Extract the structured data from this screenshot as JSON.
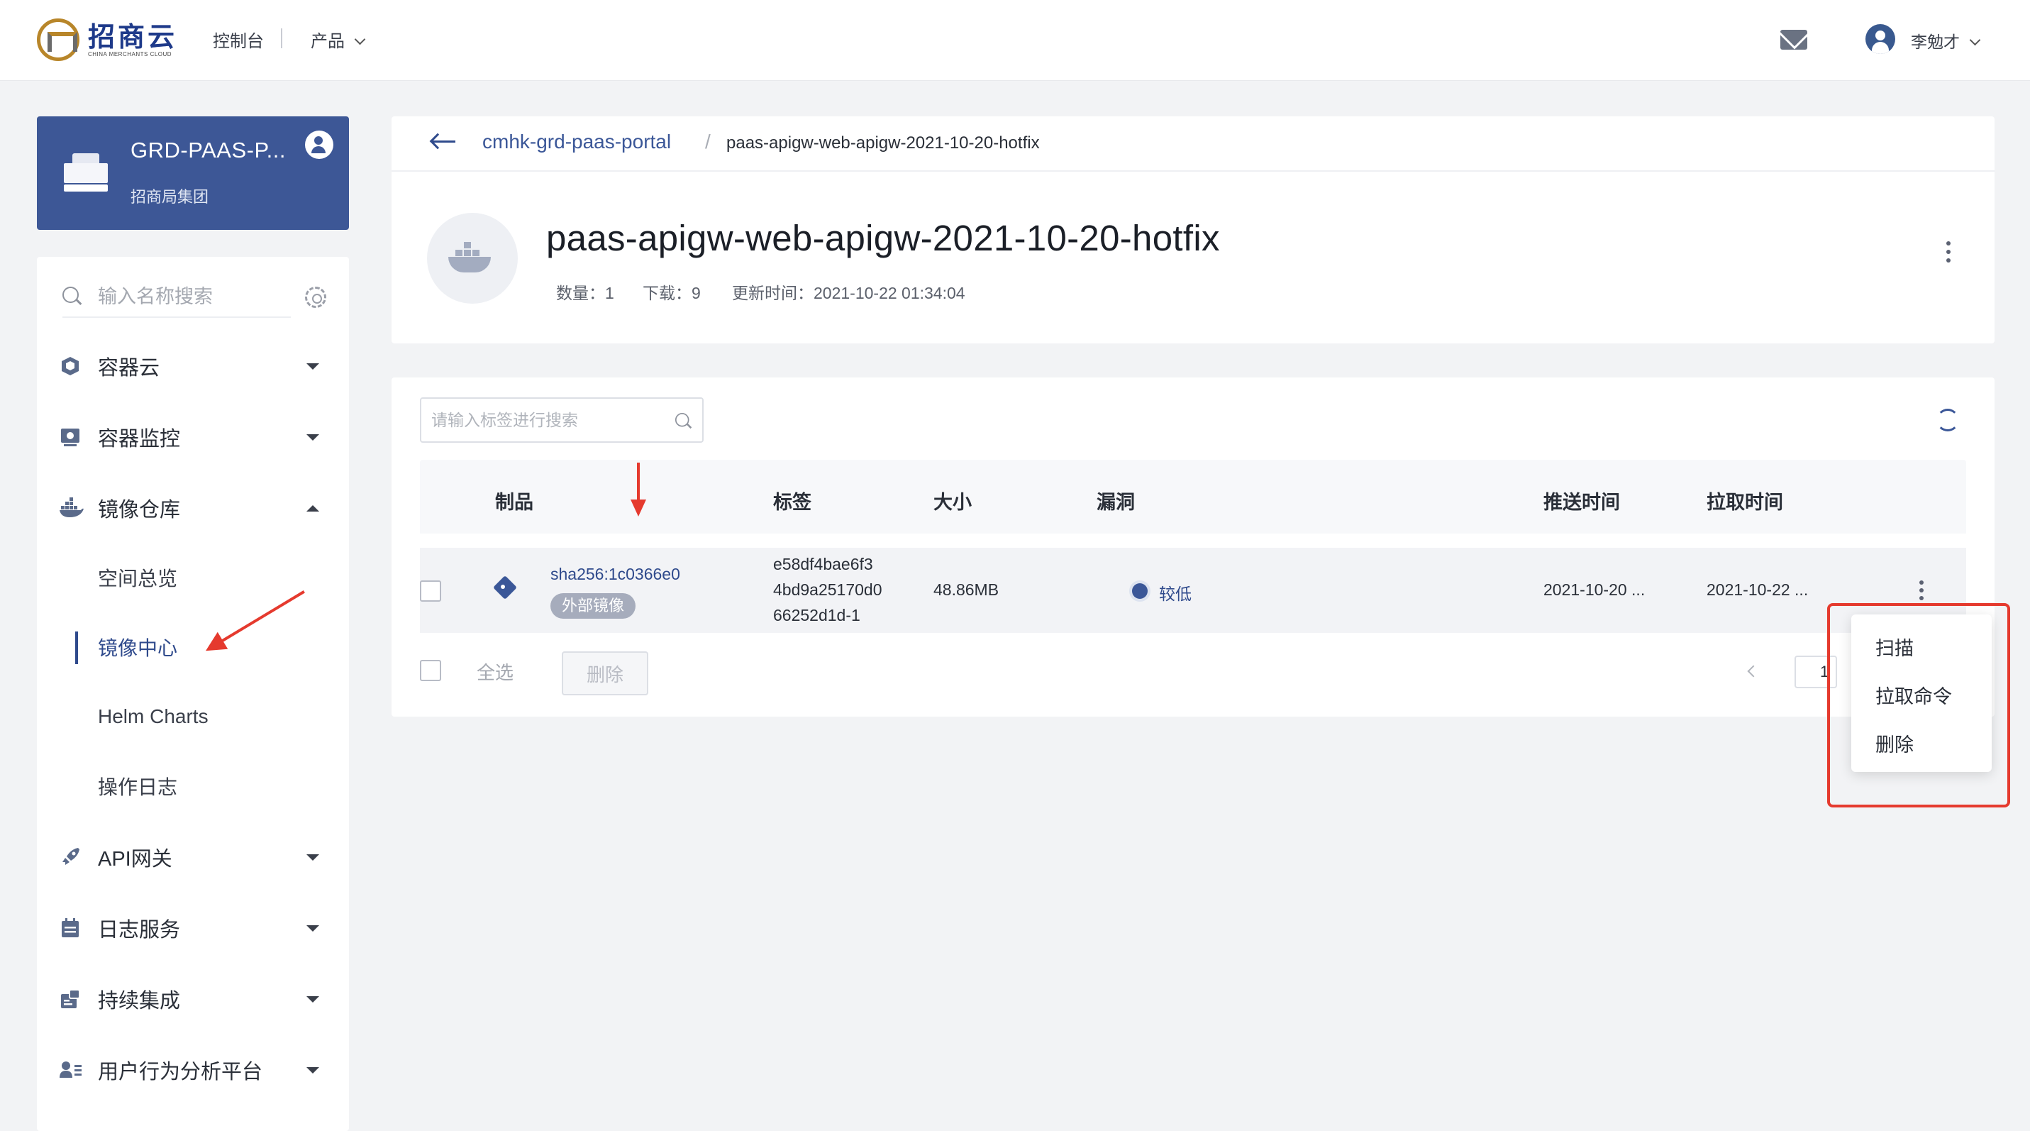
{
  "topnav": {
    "logo_cn": "招商云",
    "logo_en": "CHINA MERCHANTS CLOUD",
    "console": "控制台",
    "products": "产品",
    "username": "李勉才"
  },
  "project": {
    "name": "GRD-PAAS-P...",
    "org": "招商局集团"
  },
  "sidebar": {
    "search_placeholder": "输入名称搜索",
    "items": [
      {
        "label": "容器云",
        "icon": "cube-icon"
      },
      {
        "label": "容器监控",
        "icon": "monitor-icon"
      },
      {
        "label": "镜像仓库",
        "icon": "docker-whale-icon"
      },
      {
        "label": "API网关",
        "icon": "rocket-icon"
      },
      {
        "label": "日志服务",
        "icon": "calendar-log-icon"
      },
      {
        "label": "持续集成",
        "icon": "pipeline-icon"
      },
      {
        "label": "用户行为分析平台",
        "icon": "user-list-icon"
      }
    ],
    "sub_items": [
      "空间总览",
      "镜像中心",
      "Helm Charts",
      "操作日志"
    ],
    "active_sub": "镜像中心"
  },
  "breadcrumb": {
    "parent": "cmhk-grd-paas-portal",
    "separator": "/",
    "current": "paas-apigw-web-apigw-2021-10-20-hotfix"
  },
  "repo": {
    "title": "paas-apigw-web-apigw-2021-10-20-hotfix",
    "count": "数量：1",
    "downloads": "下载：9",
    "updated": "更新时间：2021-10-22 01:34:04"
  },
  "table": {
    "search_placeholder": "请输入标签进行搜索",
    "headers": {
      "artifact": "制品",
      "tag": "标签",
      "size": "大小",
      "vuln": "漏洞",
      "push_time": "推送时间",
      "pull_time": "拉取时间"
    },
    "rows": [
      {
        "digest": "sha256:1c0366e0",
        "badge": "外部镜像",
        "tag_line1": "e58df4bae6f3",
        "tag_line2": "4bd9a25170d0",
        "tag_line3": "66252d1d-1",
        "size": "48.86MB",
        "vuln": "较低",
        "push_time": "2021-10-20 ...",
        "pull_time": "2021-10-22 ..."
      }
    ],
    "select_all": "全选",
    "delete": "删除",
    "page": "1"
  },
  "row_menu": {
    "items": [
      "扫描",
      "拉取命令",
      "删除"
    ]
  },
  "colors": {
    "primary": "#3d5796",
    "link": "#2f4a8c",
    "annotation": "#e53a2e"
  }
}
